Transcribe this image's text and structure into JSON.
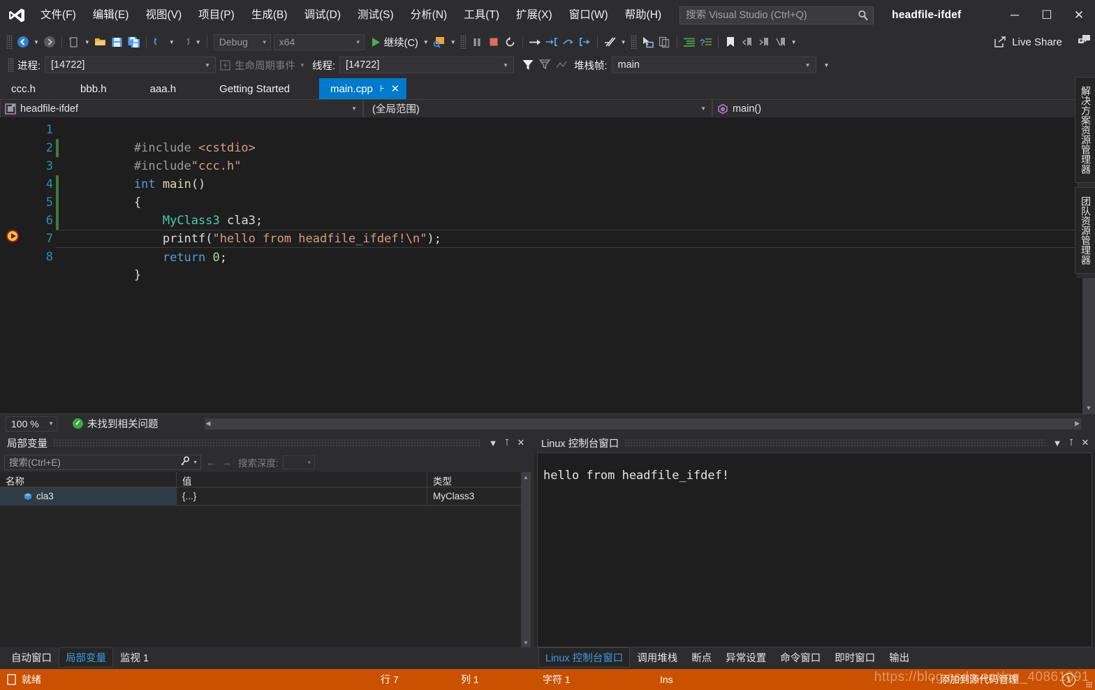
{
  "app": {
    "title": "headfile-ifdef",
    "logo_icon": "visual-studio-logo"
  },
  "menu": {
    "items": [
      {
        "label": "文件(F)"
      },
      {
        "label": "编辑(E)"
      },
      {
        "label": "视图(V)"
      },
      {
        "label": "项目(P)"
      },
      {
        "label": "生成(B)"
      },
      {
        "label": "调试(D)"
      },
      {
        "label": "测试(S)"
      },
      {
        "label": "分析(N)"
      },
      {
        "label": "工具(T)"
      },
      {
        "label": "扩展(X)"
      },
      {
        "label": "窗口(W)"
      },
      {
        "label": "帮助(H)"
      }
    ]
  },
  "search": {
    "placeholder": "搜索 Visual Studio (Ctrl+Q)",
    "value": "",
    "icon": "search-icon"
  },
  "window_controls": {
    "minimize": "─",
    "maximize": "☐",
    "close": "✕"
  },
  "toolbar": {
    "config_value": "Debug",
    "platform_value": "x64",
    "continue_label": "继续(C)",
    "live_share_label": "Live Share",
    "icons": [
      "back-arrow-icon",
      "forward-arrow-icon",
      "new-item-icon",
      "open-file-icon",
      "save-icon",
      "save-all-icon",
      "undo-icon",
      "redo-icon",
      "start-debug-icon",
      "attach-process-icon",
      "pause-icon",
      "stop-icon",
      "restart-icon",
      "show-next-statement-icon",
      "step-into-icon",
      "step-over-icon",
      "step-out-icon",
      "hot-reload-icon",
      "select-element-icon",
      "copy-icon",
      "indent-icon",
      "comment-icon",
      "bookmark-icon",
      "prev-bookmark-icon",
      "next-bookmark-icon",
      "clear-bookmarks-icon"
    ]
  },
  "debugbar": {
    "process_label": "进程:",
    "process_value": "[14722]",
    "lifecycle_label": "生命周期事件",
    "thread_label": "线程:",
    "thread_value": "[14722]",
    "stackframe_label": "堆栈帧:",
    "stackframe_value": "main"
  },
  "document_tabs": {
    "tabs": [
      {
        "label": "ccc.h",
        "active": false
      },
      {
        "label": "bbb.h",
        "active": false
      },
      {
        "label": "aaa.h",
        "active": false
      },
      {
        "label": "Getting Started",
        "active": false
      },
      {
        "label": "main.cpp",
        "active": true
      }
    ],
    "pin_icon": "pin-icon",
    "close_icon": "close-icon",
    "overflow_icon": "chevron-down-icon"
  },
  "navbar": {
    "project": "headfile-ifdef",
    "scope": "(全局范围)",
    "member": "main()",
    "project_icon": "project-icon",
    "member_icon": "method-icon"
  },
  "editor": {
    "line_numbers": [
      "1",
      "2",
      "3",
      "4",
      "5",
      "6",
      "7",
      "8"
    ],
    "lines": [
      {
        "n": 1,
        "text": "#include <cstdio>",
        "fold": true,
        "changed": false
      },
      {
        "n": 2,
        "text": "#include\"ccc.h\"",
        "fold": false,
        "changed": true
      },
      {
        "n": 3,
        "text": "int main()",
        "fold": true,
        "changed": false
      },
      {
        "n": 4,
        "text": "{",
        "fold": false,
        "changed": true
      },
      {
        "n": 5,
        "text": "    MyClass3 cla3;",
        "fold": false,
        "changed": true
      },
      {
        "n": 6,
        "text": "    printf(\"hello from headfile_ifdef!\\n\");",
        "fold": false,
        "changed": false
      },
      {
        "n": 7,
        "text": "    return 0;",
        "fold": false,
        "changed": false,
        "current": true
      },
      {
        "n": 8,
        "text": "}",
        "fold": false,
        "changed": false
      }
    ],
    "current_statement_icon": "current-statement-arrow-icon",
    "zoom_level": "100 %",
    "issues_message": "未找到相关问题",
    "ok_icon": "check-circle-icon"
  },
  "locals_panel": {
    "title": "局部变量",
    "search_placeholder": "搜索(Ctrl+E)",
    "search_value": "",
    "search_icon": "search-key-icon",
    "back_icon": "arrow-left-icon",
    "forward_icon": "arrow-right-icon",
    "depth_label": "搜索深度:",
    "depth_value": "",
    "columns": [
      "名称",
      "值",
      "类型"
    ],
    "rows": [
      {
        "name": "cla3",
        "value": "{...}",
        "type": "MyClass3",
        "icon": "object-cube-icon"
      }
    ],
    "dropdown_icon": "chevron-down-icon",
    "pin_icon": "pin-icon",
    "close_icon": "close-icon"
  },
  "locals_tabs": {
    "tabs": [
      {
        "label": "自动窗口",
        "active": false
      },
      {
        "label": "局部变量",
        "active": true
      },
      {
        "label": "监视 1",
        "active": false
      }
    ]
  },
  "console_panel": {
    "title": "Linux 控制台窗口",
    "output": "hello from headfile_ifdef!",
    "dropdown_icon": "chevron-down-icon",
    "pin_icon": "pin-icon",
    "close_icon": "close-icon"
  },
  "console_tabs": {
    "tabs": [
      {
        "label": "Linux 控制台窗口",
        "active": true
      },
      {
        "label": "调用堆栈",
        "active": false
      },
      {
        "label": "断点",
        "active": false
      },
      {
        "label": "异常设置",
        "active": false
      },
      {
        "label": "命令窗口",
        "active": false
      },
      {
        "label": "即时窗口",
        "active": false
      },
      {
        "label": "输出",
        "active": false
      }
    ]
  },
  "right_rail": {
    "tabs": [
      {
        "label": "解决方案资源管理器"
      },
      {
        "label": "团队资源管理器"
      }
    ]
  },
  "statusbar": {
    "ready": "就绪",
    "ready_icon": "ready-icon",
    "row_label": "行 7",
    "col_label": "列 1",
    "char_label": "字符 1",
    "ins_label": "Ins",
    "add_source_control": "添加到源代码管理",
    "add_icon": "arrow-up-icon",
    "notification_count": "1",
    "watermark": "https://blog.csdn.net/qq_40861091"
  },
  "colors": {
    "accent": "#007acc",
    "status_bar": "#ca5100",
    "editor_bg": "#1e1e1e",
    "chrome_bg": "#2d2d30",
    "panel_bg": "#252526"
  }
}
